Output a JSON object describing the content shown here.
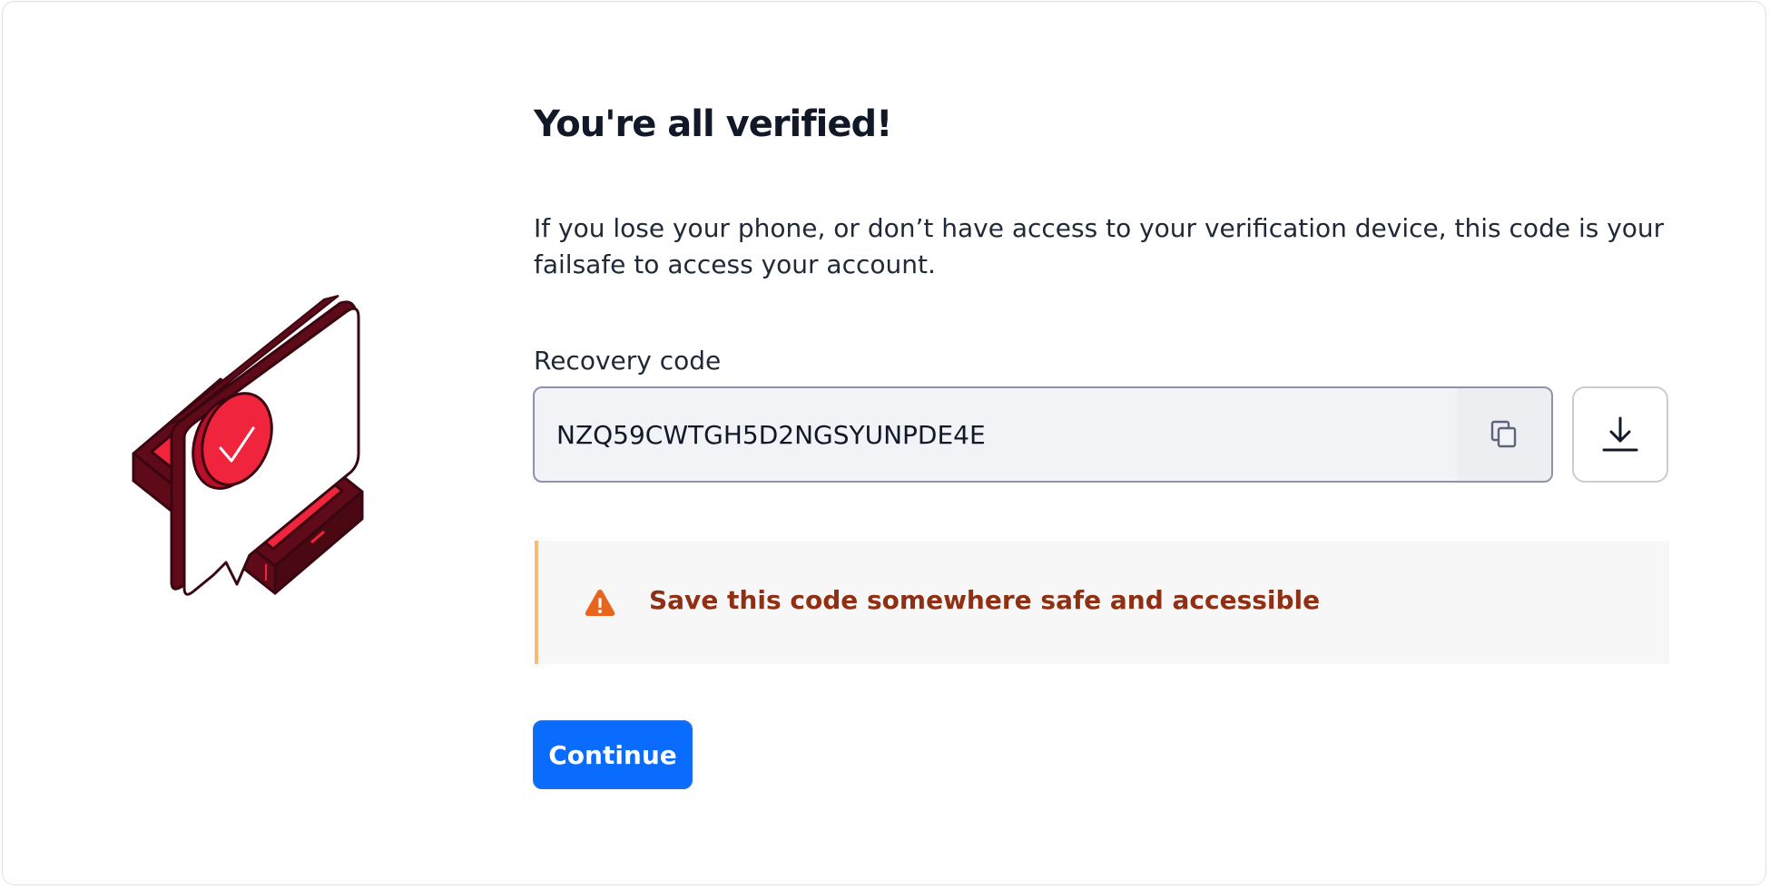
{
  "title": "You're all verified!",
  "description": "If you lose your phone, or don’t have access to your verification device, this code is your failsafe to access your account.",
  "recovery": {
    "label": "Recovery code",
    "code": "NZQ59CWTGH5D2NGSYUNPDE4E",
    "copy_icon": "copy-icon",
    "download_icon": "download-icon"
  },
  "warning": {
    "icon": "warning-icon",
    "text": "Save this code somewhere safe and accessible"
  },
  "continue_label": "Continue",
  "colors": {
    "primary": "#0a6cff",
    "warning_text": "#8f2f14",
    "warning_accent": "#f8b97b",
    "warning_icon": "#e8651d",
    "illustration_red": "#f0243c",
    "illustration_dark": "#5e0a19"
  }
}
